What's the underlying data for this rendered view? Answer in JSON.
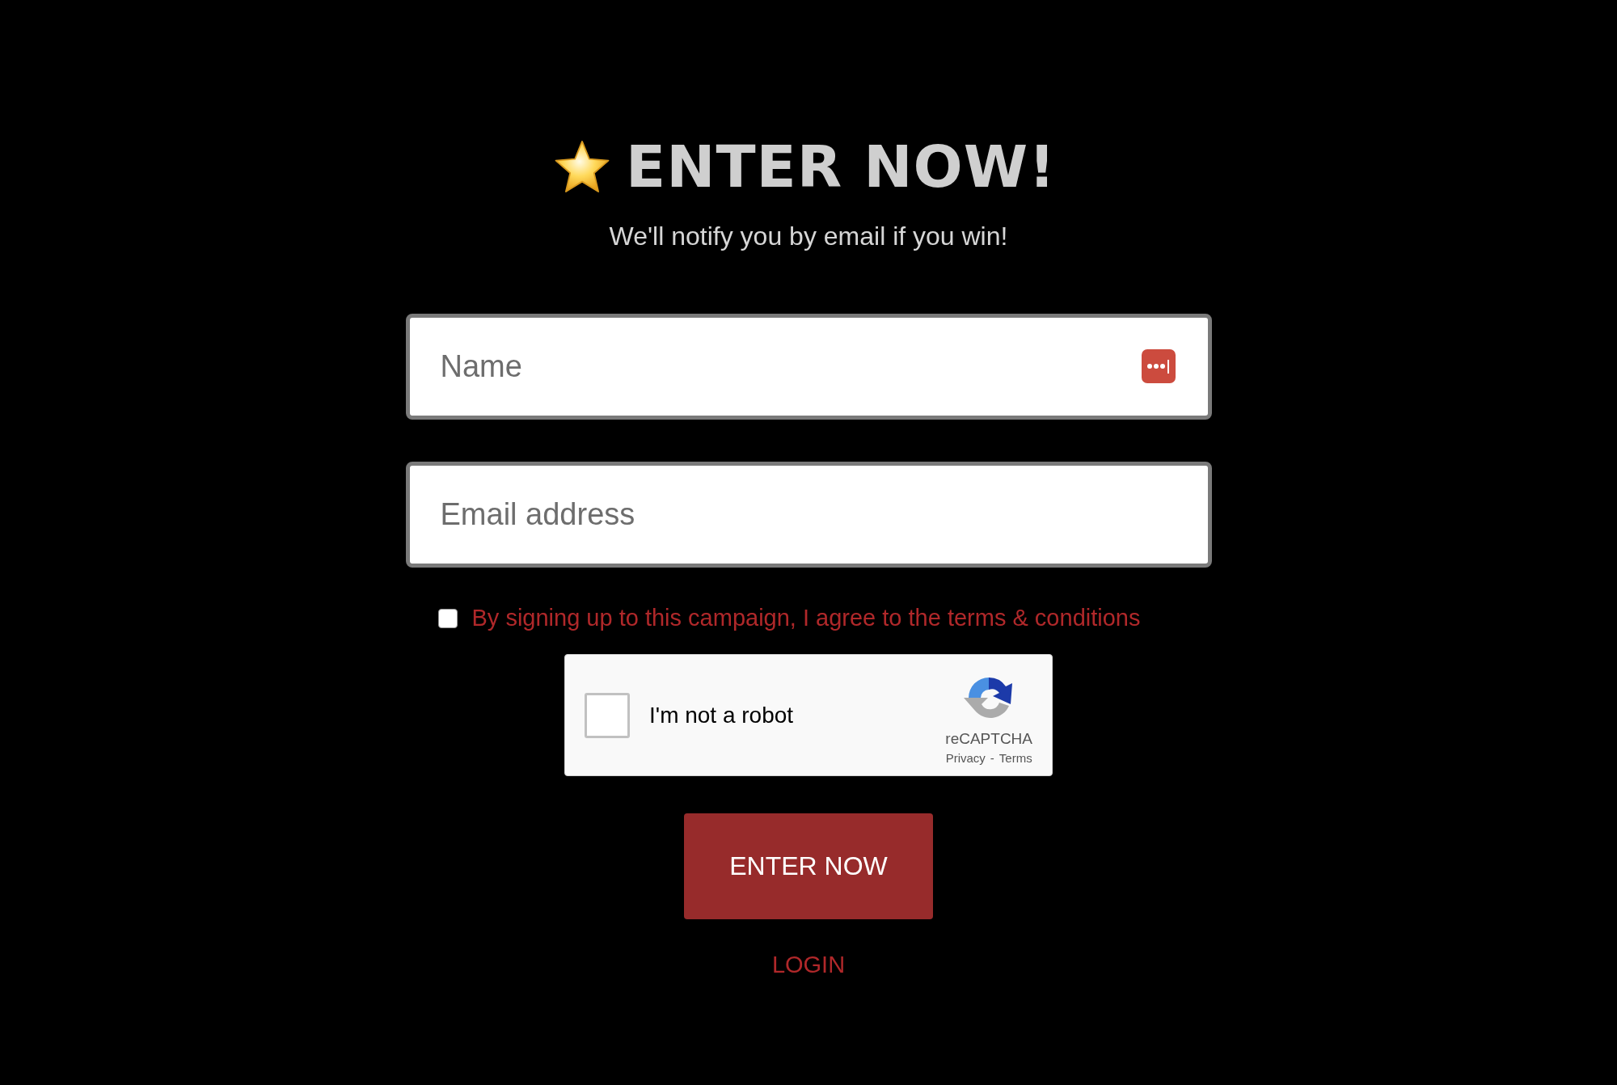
{
  "title": "ENTER NOW!",
  "subtitle": "We'll notify you by email if you win!",
  "fields": [
    {
      "placeholder": "Name",
      "kind": "password-manager"
    },
    {
      "placeholder": "Email address",
      "kind": "plain"
    }
  ],
  "terms": {
    "label": "By signing up to this campaign, I agree to the terms & conditions",
    "checked": false
  },
  "captcha": {
    "label": "I'm not a robot",
    "checked": false,
    "brand": "reCAPTCHA",
    "privacy": "Privacy",
    "separator": "-",
    "terms": "Terms"
  },
  "submit": "ENTER NOW",
  "login": "LOGIN"
}
